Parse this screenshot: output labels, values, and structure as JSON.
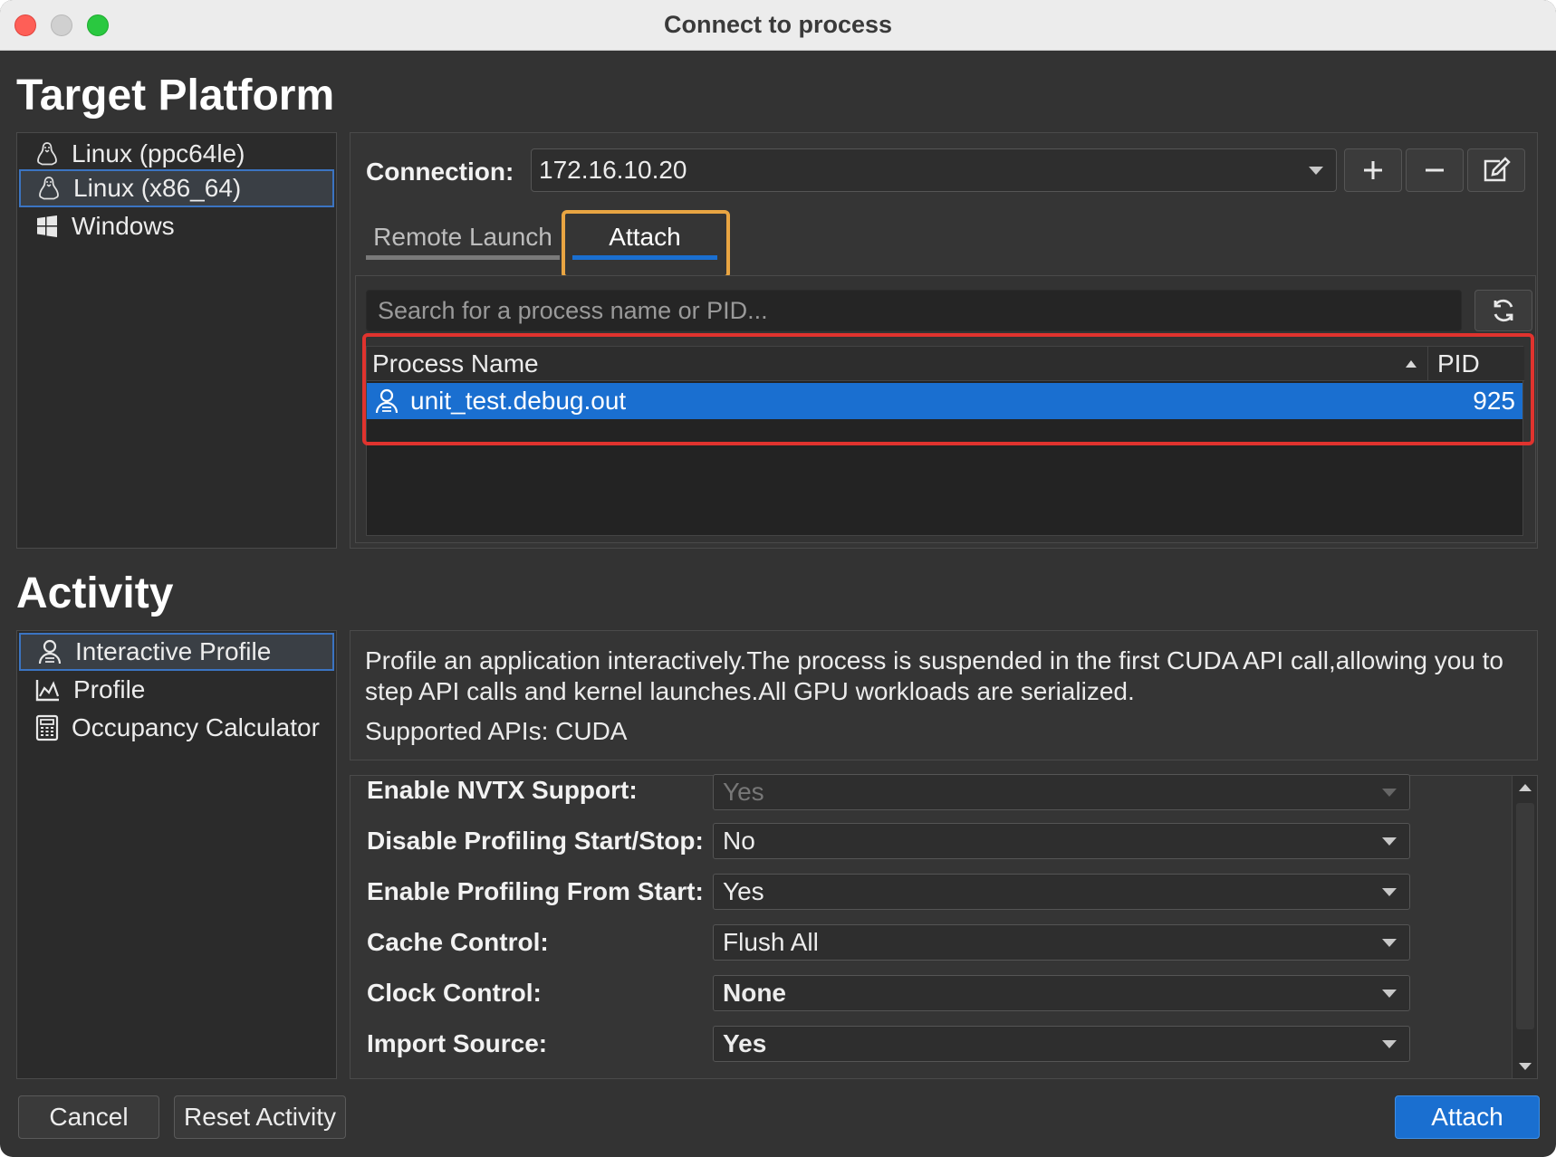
{
  "window": {
    "title": "Connect to process"
  },
  "target_platform": {
    "heading": "Target Platform",
    "items": [
      {
        "label": "Linux (ppc64le)",
        "icon": "linux-icon"
      },
      {
        "label": "Linux (x86_64)",
        "icon": "linux-icon",
        "selected": true
      },
      {
        "label": "Windows",
        "icon": "windows-icon"
      }
    ]
  },
  "connection": {
    "label": "Connection:",
    "value": "172.16.10.20",
    "buttons": [
      "add-icon",
      "remove-icon",
      "edit-icon"
    ]
  },
  "tabs": [
    {
      "label": "Remote Launch",
      "active": false
    },
    {
      "label": "Attach",
      "active": true
    }
  ],
  "search": {
    "placeholder": "Search for a process name or PID..."
  },
  "process_table": {
    "columns": [
      "Process Name",
      "PID"
    ],
    "rows": [
      {
        "name": "unit_test.debug.out",
        "pid": "925"
      }
    ]
  },
  "activity": {
    "heading": "Activity",
    "items": [
      {
        "label": "Interactive Profile",
        "icon": "user-profile-icon",
        "selected": true
      },
      {
        "label": "Profile",
        "icon": "chart-icon"
      },
      {
        "label": "Occupancy Calculator",
        "icon": "calculator-icon"
      }
    ],
    "description": "Profile an application interactively.The process is suspended in the first CUDA API call,allowing you to step API calls and kernel launches.All GPU workloads are serialized.",
    "supported_apis": "Supported APIs: CUDA"
  },
  "settings": [
    {
      "label": "Enable NVTX Support:",
      "value": "Yes",
      "disabled": true
    },
    {
      "label": "Disable Profiling Start/Stop:",
      "value": "No"
    },
    {
      "label": "Enable Profiling From Start:",
      "value": "Yes"
    },
    {
      "label": "Cache Control:",
      "value": "Flush All"
    },
    {
      "label": "Clock Control:",
      "value": "None"
    },
    {
      "label": "Import Source:",
      "value": "Yes"
    }
  ],
  "footer": {
    "cancel": "Cancel",
    "reset": "Reset Activity",
    "attach": "Attach"
  },
  "colors": {
    "accent": "#1a6fd0",
    "highlight_tab": "#e9a542",
    "highlight_table": "#e0332e"
  }
}
